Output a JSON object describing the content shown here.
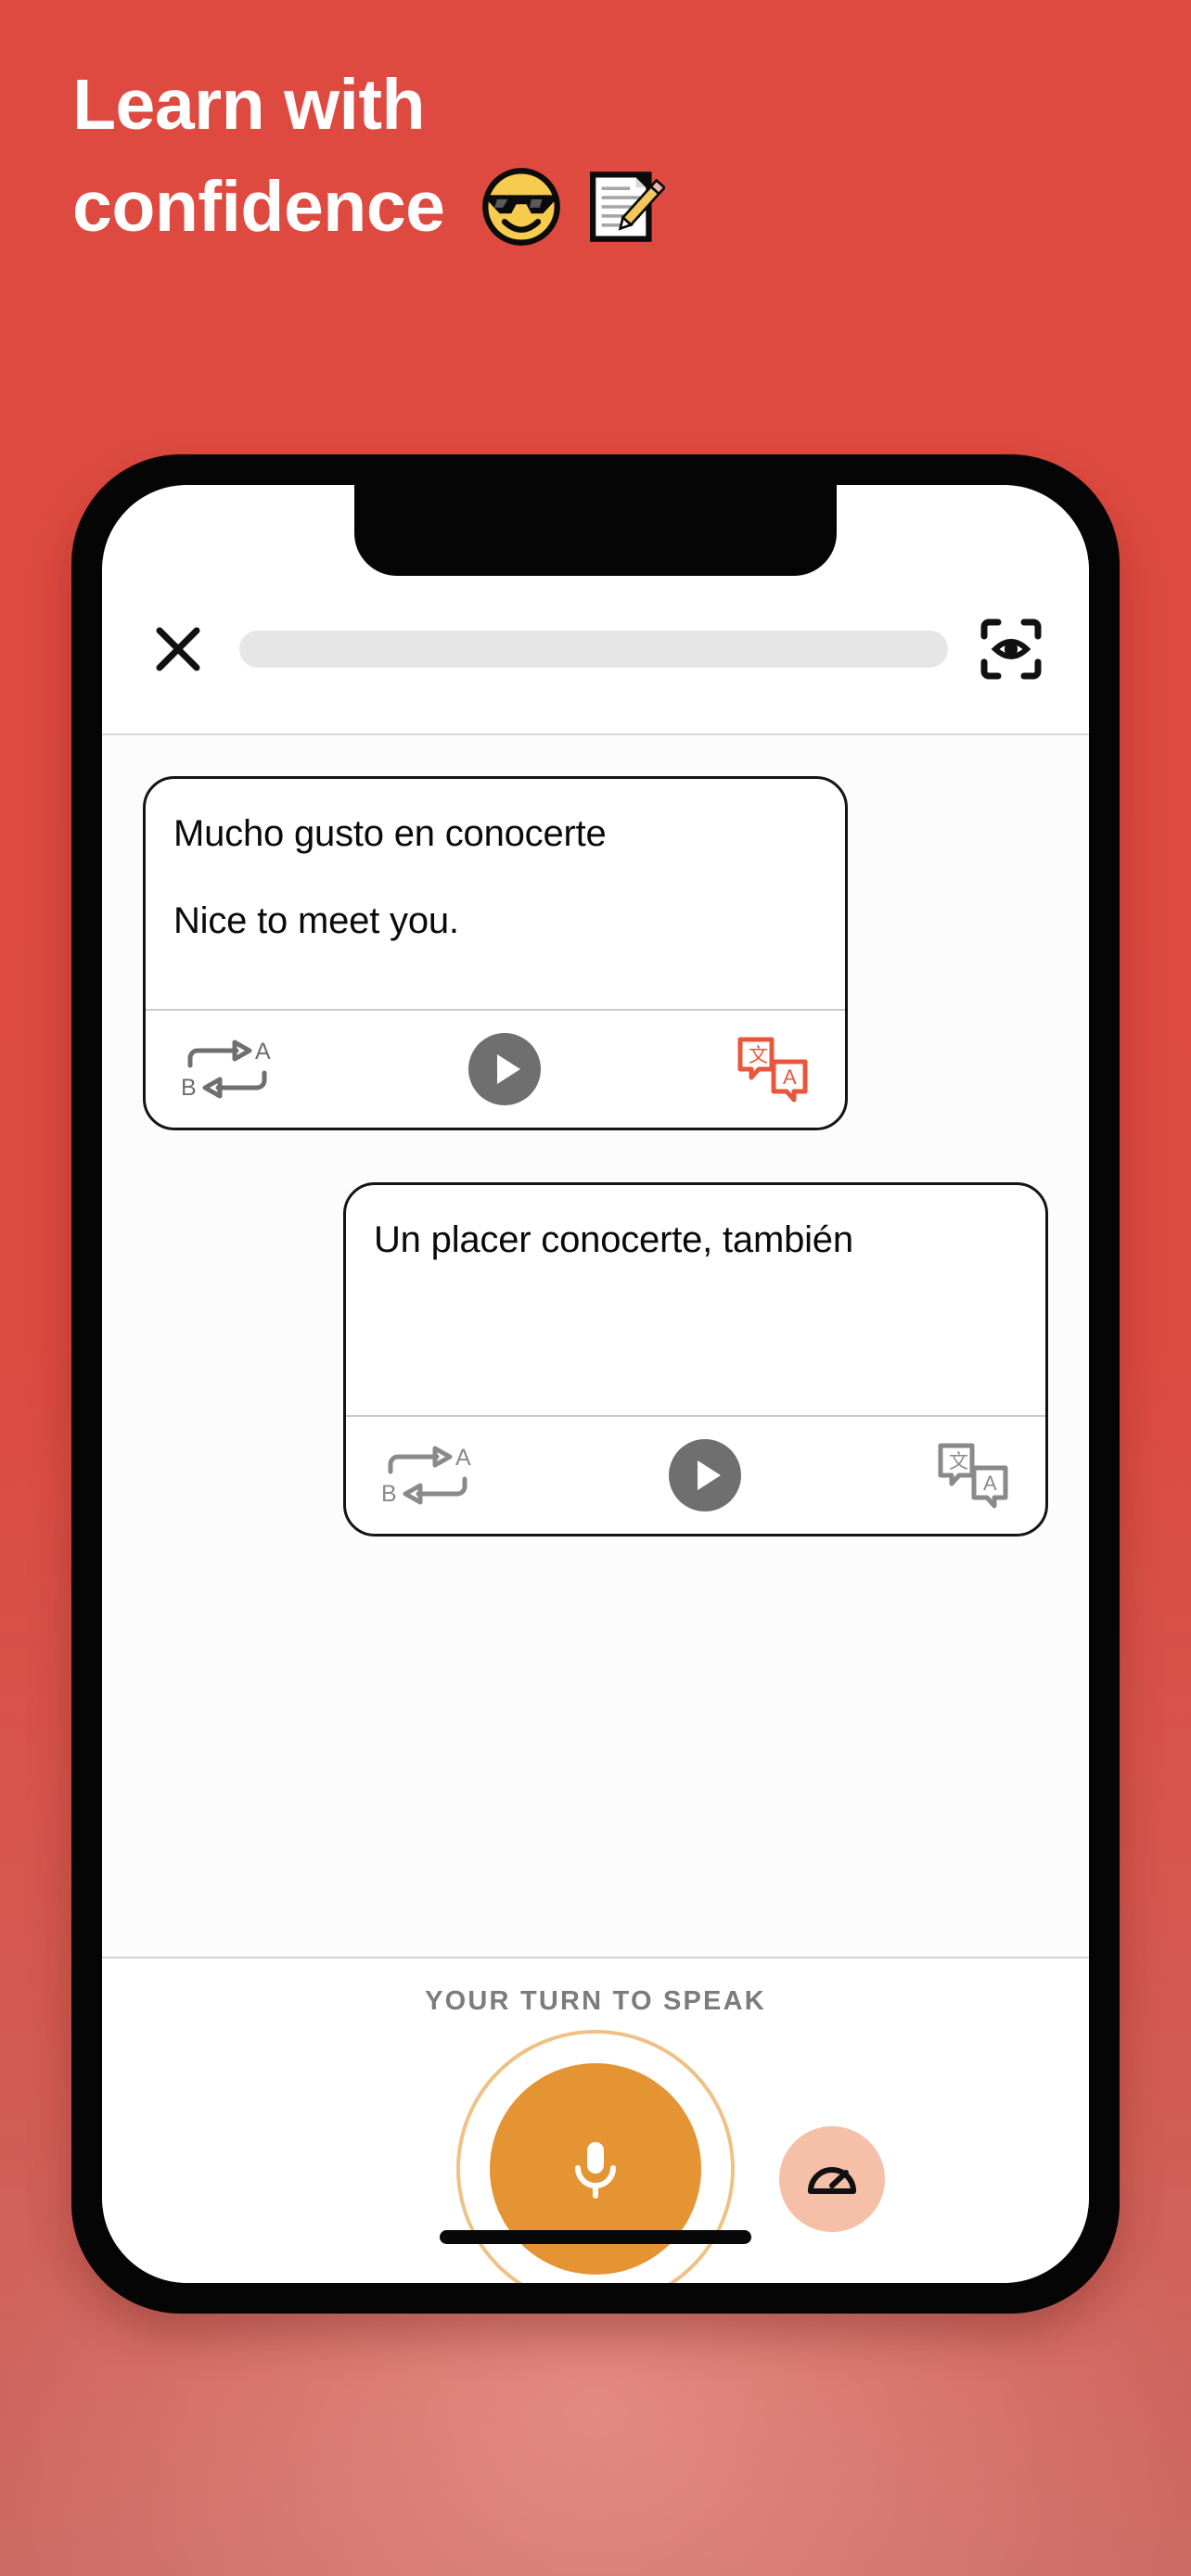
{
  "promo": {
    "headline_line1": "Learn with",
    "headline_line2": "confidence",
    "emoji1_name": "smiling-face-with-sunglasses-emoji",
    "emoji2_name": "memo-pencil-emoji",
    "background_top_color": "#DF4A40",
    "background_bottom_color": "#CC6B65",
    "headline_color": "#FFFFFF"
  },
  "app": {
    "topbar": {
      "close_icon": "close-icon",
      "progress_percent": 0,
      "progress_track_color": "#E6E6E6",
      "scan_icon": "scan-eye-icon"
    },
    "conversation": [
      {
        "align": "left",
        "primary_text": "Mucho gusto en conocerte",
        "secondary_text": "Nice to meet you.",
        "toolbar": {
          "repeat_icon": "swap-ab-repeat-icon",
          "repeat_label_top": "A",
          "repeat_label_bottom": "B",
          "play_icon": "play-icon",
          "play_color": "#6F6F6F",
          "translate_icon": "translate-icon",
          "translate_color": "#E8573C",
          "translate_active": true
        }
      },
      {
        "align": "right",
        "primary_text": "Un placer conocerte, también",
        "secondary_text": "",
        "toolbar": {
          "repeat_icon": "swap-ab-repeat-icon",
          "repeat_label_top": "A",
          "repeat_label_bottom": "B",
          "play_icon": "play-icon",
          "play_color": "#6F6F6F",
          "translate_icon": "translate-icon",
          "translate_color": "#8A8A8A",
          "translate_active": false
        }
      }
    ],
    "speak_bar": {
      "prompt_label": "YOUR TURN TO SPEAK",
      "prompt_color": "#7C7C7C",
      "mic_icon": "microphone-icon",
      "mic_color": "#E59434",
      "mic_ring_color": "#F0C187",
      "speed_icon": "speedometer-icon",
      "speed_bg_color": "#F5BFA8"
    }
  }
}
